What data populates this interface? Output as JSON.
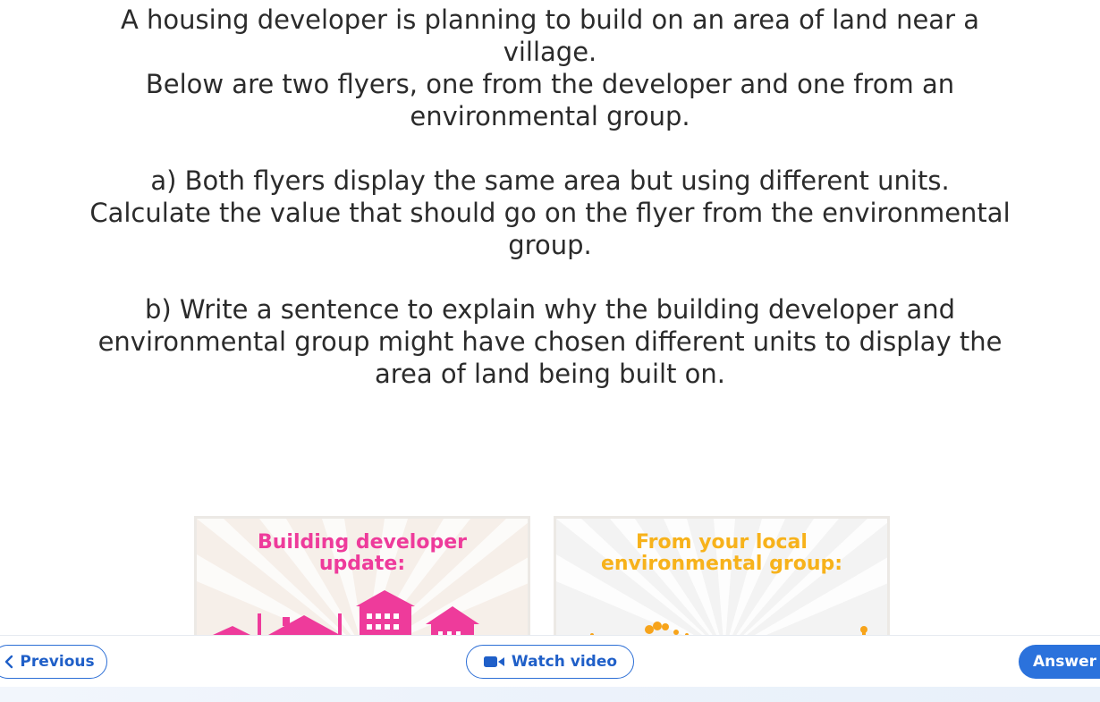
{
  "question": {
    "intro_line1a": "A housing developer is planning to build on an area of land near a",
    "intro_line1b": "village.",
    "intro_line2a": "Below are two flyers, one from the developer and one from an",
    "intro_line2b": "environmental group.",
    "part_a_line1": "a) Both flyers display the same area but using different units.",
    "part_a_line2": "Calculate the value that should go on the flyer from the environmental",
    "part_a_line3": "group.",
    "part_b_line1": "b) Write a sentence to explain why the building developer and",
    "part_b_line2": "environmental group might have chosen different units to display the",
    "part_b_line3": "area of land being built on."
  },
  "flyers": {
    "developer": {
      "title_line1": "Building developer",
      "title_line2": "update:",
      "color": "#ee3b9b"
    },
    "environmental": {
      "title_line1": "From your local",
      "title_line2": "environmental group:",
      "color": "#f7b21b"
    }
  },
  "nav": {
    "previous_label": "Previous",
    "previous_icon": "chevron-left-icon",
    "video_label": "Watch video",
    "video_icon": "video-camera-icon",
    "answer_label": "Answer",
    "accent": "#2b72dc"
  }
}
